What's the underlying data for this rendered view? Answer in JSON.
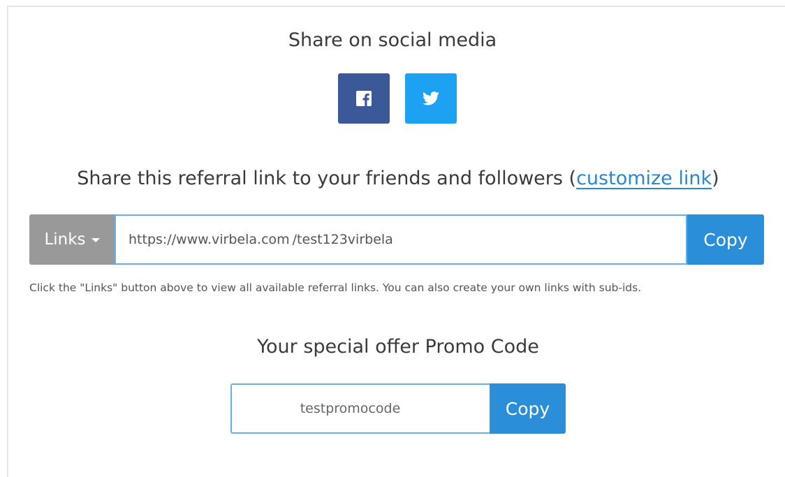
{
  "colors": {
    "facebook": "#3b5998",
    "twitter": "#1da1f2",
    "links_button": "#999999",
    "copy_button": "#2a8fd8",
    "link_text": "#2a88c8",
    "input_border": "#66afe9"
  },
  "social": {
    "heading": "Share on social media",
    "buttons": [
      {
        "network": "facebook",
        "icon": "facebook-icon"
      },
      {
        "network": "twitter",
        "icon": "twitter-icon"
      }
    ]
  },
  "referral": {
    "heading_prefix": "Share this referral link to your friends and followers (",
    "customize_link": "customize link",
    "heading_suffix": ")",
    "links_button": "Links",
    "link_base": "https://www.virbela.com",
    "link_path": "/test123virbela",
    "copy_label": "Copy",
    "help_text": "Click the \"Links\" button above to view all available referral links. You can also create your own links with sub-ids."
  },
  "promo": {
    "heading": "Your special offer Promo Code",
    "code": "testpromocode",
    "copy_label": "Copy"
  }
}
